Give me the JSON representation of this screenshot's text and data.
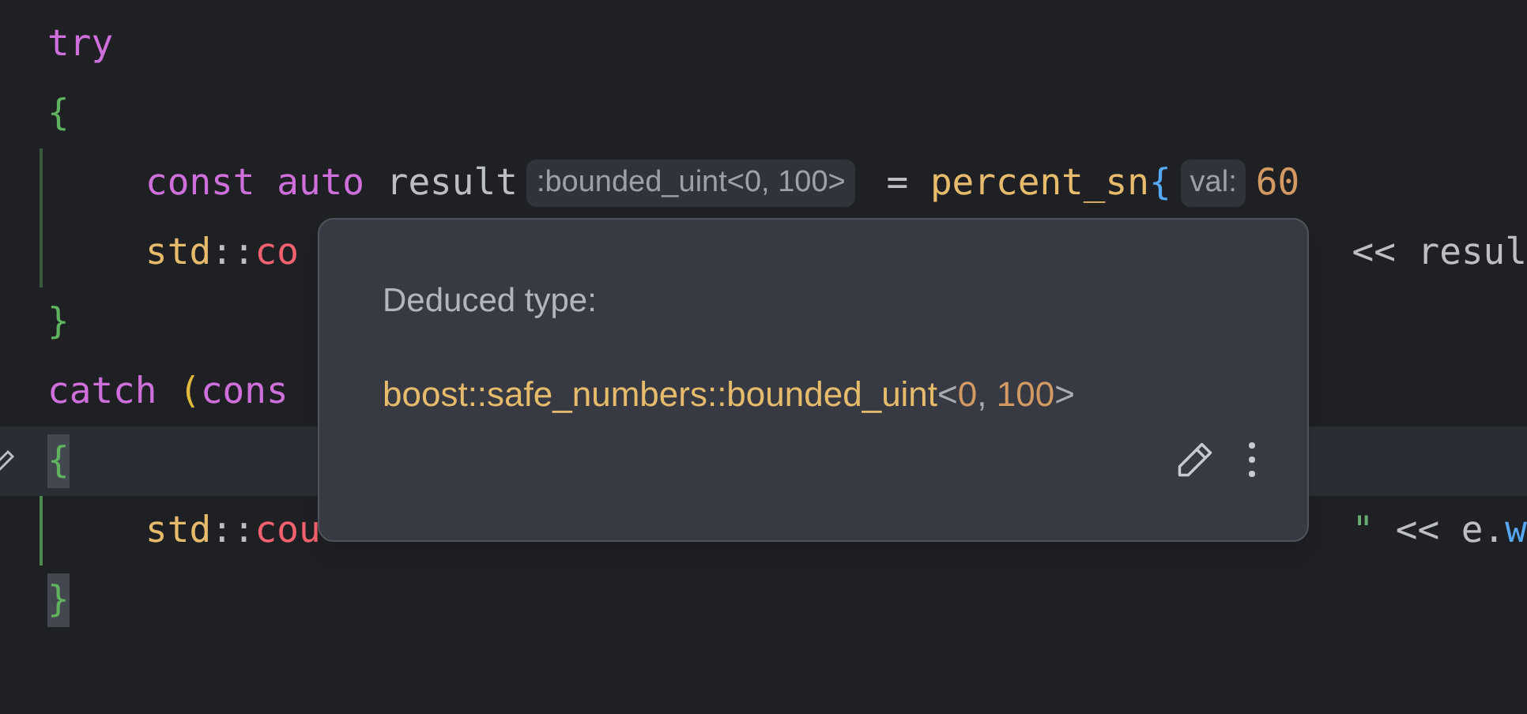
{
  "editor": {
    "lines": [
      {
        "segments": [
          {
            "kind": "keyword",
            "text": "try"
          }
        ]
      },
      {
        "segments": [
          {
            "kind": "brace",
            "text": "{"
          }
        ]
      },
      {
        "indent": true,
        "changed": true,
        "segments": [
          {
            "kind": "keyword",
            "text": "const "
          },
          {
            "kind": "keyword",
            "text": "auto "
          },
          {
            "kind": "plain",
            "text": "result"
          },
          {
            "kind": "hint",
            "text": ":bounded_uint<0, 100>"
          },
          {
            "kind": "plain",
            "text": " = "
          },
          {
            "kind": "function",
            "text": "percent_sn"
          },
          {
            "kind": "call",
            "text": "{"
          },
          {
            "kind": "hint",
            "text": "val:"
          },
          {
            "kind": "number",
            "text": "60"
          }
        ]
      },
      {
        "indent": true,
        "changed": true,
        "segments": [
          {
            "kind": "function",
            "text": "std"
          },
          {
            "kind": "plain",
            "text": "::"
          },
          {
            "kind": "member",
            "text": "co"
          }
        ],
        "tail": [
          {
            "kind": "plain",
            "text": "<< resul"
          }
        ]
      },
      {
        "segments": [
          {
            "kind": "brace",
            "text": "}"
          }
        ]
      },
      {
        "segments": [
          {
            "kind": "keyword",
            "text": "catch "
          },
          {
            "kind": "paren",
            "text": "("
          },
          {
            "kind": "keyword",
            "text": "cons"
          }
        ]
      },
      {
        "current": true,
        "gutter_icon": true,
        "segments": [
          {
            "kind": "matched",
            "text": "{"
          }
        ]
      },
      {
        "indent": true,
        "added": true,
        "segments": [
          {
            "kind": "function",
            "text": "std"
          },
          {
            "kind": "plain",
            "text": "::"
          },
          {
            "kind": "member",
            "text": "cou"
          }
        ],
        "tail": [
          {
            "kind": "string",
            "text": "\""
          },
          {
            "kind": "plain",
            "text": " << e."
          },
          {
            "kind": "call",
            "text": "w"
          }
        ]
      },
      {
        "segments": [
          {
            "kind": "matched",
            "text": "}"
          }
        ]
      }
    ]
  },
  "popup": {
    "label": "Deduced type:",
    "type": [
      {
        "kind": "type",
        "text": "boost::safe_numbers::bounded_uint"
      },
      {
        "kind": "punct",
        "text": "<"
      },
      {
        "kind": "number",
        "text": "0"
      },
      {
        "kind": "punct",
        "text": ", "
      },
      {
        "kind": "number",
        "text": "100"
      },
      {
        "kind": "punct",
        "text": ">"
      }
    ]
  }
}
